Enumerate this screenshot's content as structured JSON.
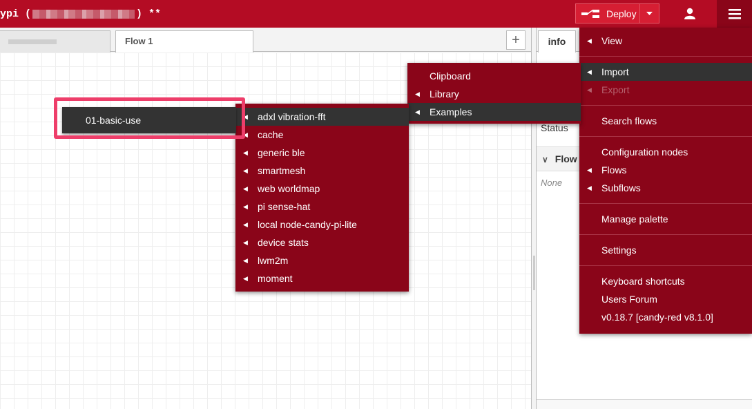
{
  "header": {
    "title_prefix": "ypi (",
    "title_suffix": ") **",
    "deploy_label": "Deploy"
  },
  "workspace": {
    "tabs": [
      {
        "label": ""
      },
      {
        "label": "Flow 1"
      }
    ],
    "add_tab_symbol": "+"
  },
  "sidebar": {
    "active_tab": "info",
    "status_label": "Status",
    "flow_section": "Flow",
    "none_label": "None"
  },
  "main_menu": {
    "items": [
      {
        "label": "View"
      },
      {
        "label": "Import"
      },
      {
        "label": "Export"
      },
      {
        "label": "Search flows"
      },
      {
        "label": "Configuration nodes"
      },
      {
        "label": "Flows"
      },
      {
        "label": "Subflows"
      },
      {
        "label": "Manage palette"
      },
      {
        "label": "Settings"
      },
      {
        "label": "Keyboard shortcuts"
      },
      {
        "label": "Users Forum"
      },
      {
        "label": "v0.18.7 [candy-red v8.1.0]"
      }
    ]
  },
  "import_menu": {
    "items": [
      {
        "label": "Clipboard"
      },
      {
        "label": "Library"
      },
      {
        "label": "Examples"
      }
    ]
  },
  "examples_menu": {
    "items": [
      {
        "label": "adxl vibration-fft"
      },
      {
        "label": "cache"
      },
      {
        "label": "generic ble"
      },
      {
        "label": "smartmesh"
      },
      {
        "label": "web worldmap"
      },
      {
        "label": "pi sense-hat"
      },
      {
        "label": "local node-candy-pi-lite"
      },
      {
        "label": "device stats"
      },
      {
        "label": "lwm2m"
      },
      {
        "label": "moment"
      }
    ]
  },
  "submenu_item": {
    "label": "01-basic-use"
  },
  "colors": {
    "header": "#b40c24",
    "menu_bg": "#8a0519",
    "active_item": "#333333",
    "deploy_bg": "#d61e33",
    "highlight": "#ee3e6a"
  },
  "icons": [
    "deploy-icon",
    "caret-down-icon",
    "user-icon",
    "hamburger-menu-icon",
    "caret-left-icon",
    "chevron-down-icon",
    "plus-icon"
  ]
}
